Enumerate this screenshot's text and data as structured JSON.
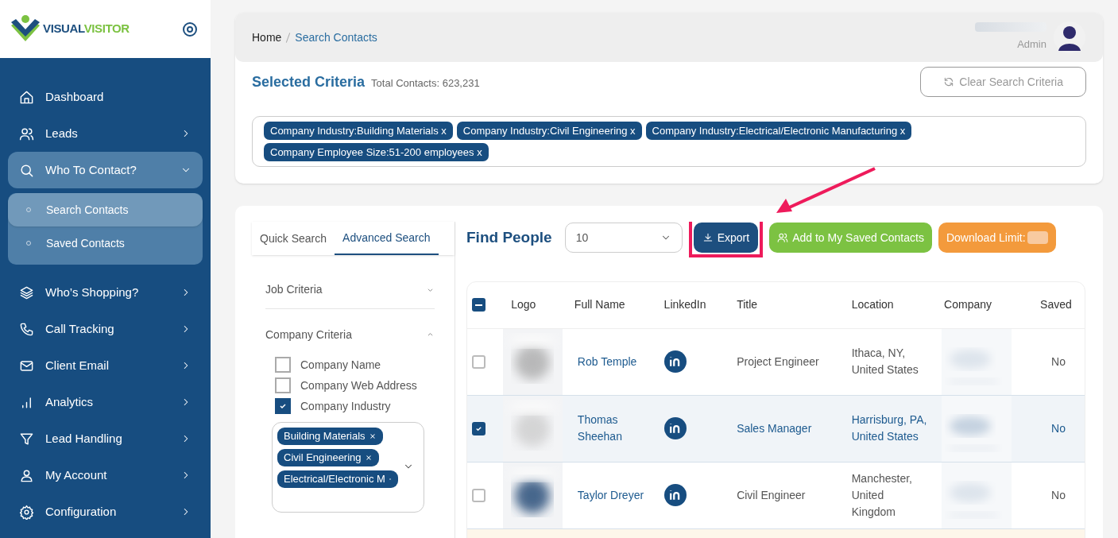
{
  "brand": {
    "part_1": "VISUAL",
    "part_2": "VISITOR"
  },
  "sidebar": {
    "items": [
      {
        "label": "Dashboard",
        "kind": "plain",
        "selected": false
      },
      {
        "label": "Leads",
        "kind": "link",
        "selected": false
      },
      {
        "label": "Who To Contact?",
        "kind": "group",
        "expanded": true,
        "selected": true,
        "children": [
          {
            "label": "Search Contacts",
            "selected": true
          },
          {
            "label": "Saved Contacts",
            "selected": false
          }
        ]
      },
      {
        "label": "Who’s Shopping?",
        "kind": "link",
        "selected": false
      },
      {
        "label": "Call Tracking",
        "kind": "link",
        "selected": false
      },
      {
        "label": "Client Email",
        "kind": "link",
        "selected": false
      },
      {
        "label": "Analytics",
        "kind": "link",
        "selected": false
      },
      {
        "label": "Lead Handling",
        "kind": "link",
        "selected": false
      },
      {
        "label": "My Account",
        "kind": "link",
        "selected": false
      },
      {
        "label": "Configuration",
        "kind": "link",
        "selected": false
      }
    ]
  },
  "breadcrumb": [
    "Home",
    "Search Contacts"
  ],
  "user": {
    "role": "Admin"
  },
  "selected_criteria": {
    "title": "Selected Criteria",
    "total": "Total Contacts: 623,231",
    "clear_button": "Clear Search Criteria",
    "tags": [
      "Company Industry:Building Materials x",
      "Company Industry:Civil Engineering x",
      "Company Industry:Electrical/Electronic Manufacturing x",
      "Company Employee Size:51-200 employees x"
    ]
  },
  "filters": {
    "tabs": [
      {
        "label": "Quick Search",
        "selected": false
      },
      {
        "label": "Advanced Search",
        "selected": true
      }
    ],
    "sections": [
      {
        "title": "Job Criteria",
        "expanded": false
      },
      {
        "title": "Company Criteria",
        "expanded": true,
        "options": [
          {
            "label": "Company Name",
            "checked": false
          },
          {
            "label": "Company Web Address",
            "checked": false
          },
          {
            "label": "Company Industry",
            "checked": true
          }
        ],
        "industry_tags": [
          "Building Materials",
          "Civil Engineering",
          "Electrical/Electronic M"
        ]
      }
    ]
  },
  "results": {
    "title": "Find People",
    "page_size": "10",
    "export_button": "Export",
    "save_button": "Add to My Saved Contacts",
    "download_limit": "Download Limit:",
    "table": {
      "select_all": {
        "indeterminate": true
      },
      "columns": [
        "Logo",
        "Full Name",
        "LinkedIn",
        "Title",
        "Location",
        "Company",
        "Saved"
      ],
      "rows": [
        {
          "selected": false,
          "name": "Rob Temple",
          "title": "Project Engineer",
          "location": "Ithaca, NY, United States",
          "saved": "No"
        },
        {
          "selected": true,
          "name": "Thomas Sheehan",
          "title": "Sales Manager",
          "location": "Harrisburg, PA, United States",
          "saved": "No"
        },
        {
          "selected": false,
          "name": "Taylor Dreyer",
          "title": "Civil Engineer",
          "location": "Manchester, United Kingdom",
          "saved": "No"
        }
      ]
    }
  }
}
